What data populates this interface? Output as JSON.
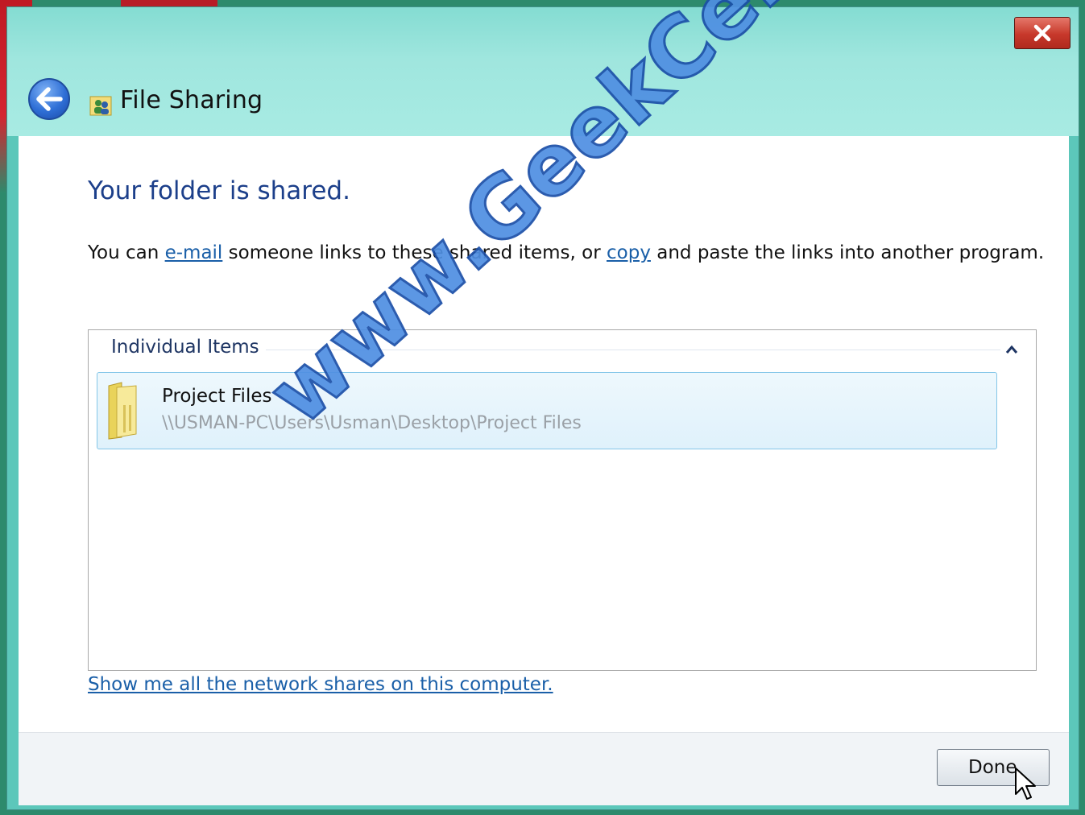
{
  "window": {
    "title": "File Sharing",
    "close_label": "x"
  },
  "main": {
    "heading": "Your folder is shared.",
    "desc_prefix": "You can ",
    "email_link": "e-mail",
    "desc_middle": " someone links to these shared items, or ",
    "copy_link": "copy",
    "desc_suffix": " and paste the links into another program."
  },
  "items": {
    "group_label": "Individual Items",
    "list": [
      {
        "name": "Project Files",
        "path": "\\\\USMAN-PC\\Users\\Usman\\Desktop\\Project Files"
      }
    ]
  },
  "show_shares_link": "Show me all the network shares on this computer.",
  "footer": {
    "done_label": "Done"
  },
  "watermark": "www.GeekCert.com",
  "colors": {
    "heading": "#1c3f8a",
    "link": "#1a5fa8",
    "titlebar": "#9fe6de",
    "close_button": "#c7382b"
  }
}
